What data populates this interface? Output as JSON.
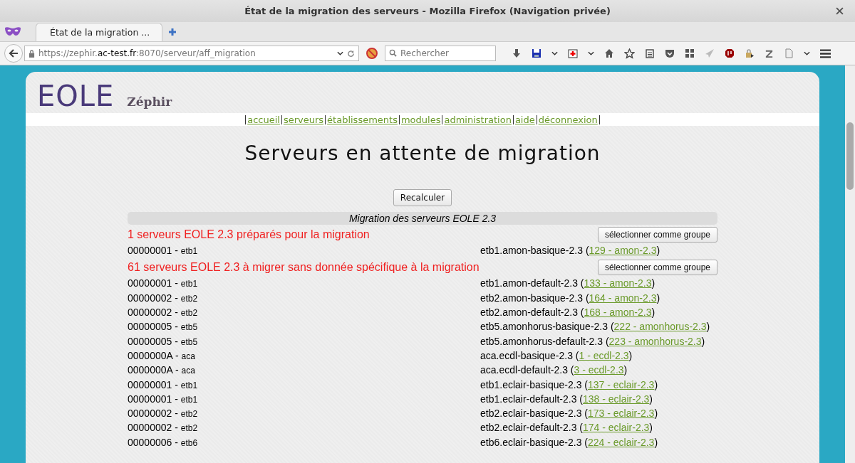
{
  "window": {
    "title": "État de la migration des serveurs - Mozilla Firefox (Navigation privée)"
  },
  "tabs": [
    {
      "label": "État de la migration ...",
      "selected": true
    }
  ],
  "address_bar": {
    "url_prefix": "https://zephir.",
    "url_host": "ac-test.fr",
    "url_suffix": ":8070/serveur/aff_migration"
  },
  "search": {
    "placeholder": "Rechercher"
  },
  "site": {
    "logo": "EOLE",
    "app_name": "Zéphir"
  },
  "nav": [
    {
      "label": "accueil"
    },
    {
      "label": "serveurs"
    },
    {
      "label": "établissements"
    },
    {
      "label": "modules"
    },
    {
      "label": "administration"
    },
    {
      "label": "aide"
    },
    {
      "label": "déconnexion"
    }
  ],
  "page_title": "Serveurs en attente de migration",
  "recalc_button": "Recalculer",
  "panel_title": "Migration des serveurs EOLE 2.3",
  "sections": [
    {
      "heading": "1 serveurs EOLE 2.3 préparés pour la migration",
      "button": "sélectionner comme groupe",
      "rows": [
        {
          "server": "00000001 -",
          "etab": "etb1",
          "variant": "etb1.amon-basique-2.3 (",
          "link": "129 - amon-2.3",
          "close": ")"
        }
      ]
    },
    {
      "heading": "61 serveurs EOLE 2.3 à migrer sans donnée spécifique à la migration",
      "button": "sélectionner comme groupe",
      "rows": [
        {
          "server": "00000001 -",
          "etab": "etb1",
          "variant": "etb1.amon-default-2.3 (",
          "link": "133 - amon-2.3",
          "close": ")"
        },
        {
          "server": "00000002 -",
          "etab": "etb2",
          "variant": "etb2.amon-basique-2.3 (",
          "link": "164 - amon-2.3",
          "close": ")"
        },
        {
          "server": "00000002 -",
          "etab": "etb2",
          "variant": "etb2.amon-default-2.3 (",
          "link": "168 - amon-2.3",
          "close": ")"
        },
        {
          "server": "00000005 -",
          "etab": "etb5",
          "variant": "etb5.amonhorus-basique-2.3 (",
          "link": "222 - amonhorus-2.3",
          "close": ")"
        },
        {
          "server": "00000005 -",
          "etab": "etb5",
          "variant": "etb5.amonhorus-default-2.3 (",
          "link": "223 - amonhorus-2.3",
          "close": ")"
        },
        {
          "server": "0000000A -",
          "etab": "aca",
          "variant": "aca.ecdl-basique-2.3 (",
          "link": "1 - ecdl-2.3",
          "close": ")"
        },
        {
          "server": "0000000A -",
          "etab": "aca",
          "variant": "aca.ecdl-default-2.3 (",
          "link": "3 - ecdl-2.3",
          "close": ")"
        },
        {
          "server": "00000001 -",
          "etab": "etb1",
          "variant": "etb1.eclair-basique-2.3 (",
          "link": "137 - eclair-2.3",
          "close": ")"
        },
        {
          "server": "00000001 -",
          "etab": "etb1",
          "variant": "etb1.eclair-default-2.3 (",
          "link": "138 - eclair-2.3",
          "close": ")"
        },
        {
          "server": "00000002 -",
          "etab": "etb2",
          "variant": "etb2.eclair-basique-2.3 (",
          "link": "173 - eclair-2.3",
          "close": ")"
        },
        {
          "server": "00000002 -",
          "etab": "etb2",
          "variant": "etb2.eclair-default-2.3 (",
          "link": "174 - eclair-2.3",
          "close": ")"
        },
        {
          "server": "00000006 -",
          "etab": "etb6",
          "variant": "etb6.eclair-basique-2.3 (",
          "link": "224 - eclair-2.3",
          "close": ")"
        }
      ]
    }
  ]
}
